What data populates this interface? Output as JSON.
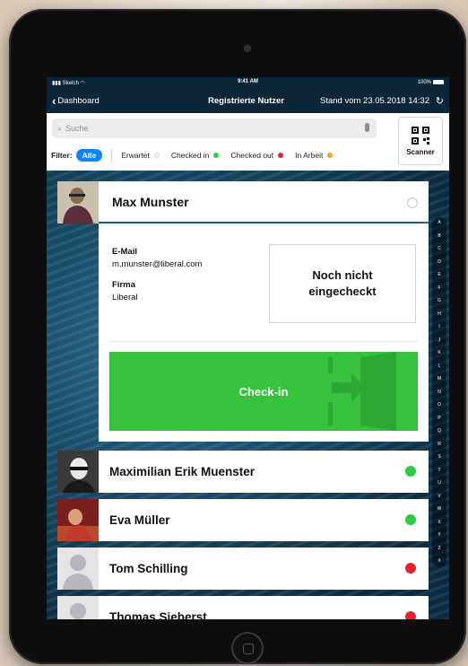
{
  "status": {
    "carrier": "Sketch",
    "time": "9:41 AM",
    "battery": "100%"
  },
  "nav": {
    "back_label": "Dashboard",
    "title": "Registrierte Nutzer",
    "stand": "Stand vom 23.05.2018 14:32"
  },
  "search": {
    "placeholder": "Suche"
  },
  "scanner": {
    "label": "Scanner"
  },
  "filters": {
    "label": "Filter:",
    "active": "Alle",
    "items": [
      {
        "label": "Erwartet",
        "color": "#ffffff"
      },
      {
        "label": "Checked in",
        "color": "#2ecc40"
      },
      {
        "label": "Checked out",
        "color": "#e8202a"
      },
      {
        "label": "In Arbeit",
        "color": "#f5a623"
      }
    ]
  },
  "selected": {
    "name": "Max Munster",
    "email_label": "E-Mail",
    "email": "m.munster@liberal.com",
    "company_label": "Firma",
    "company": "Liberal",
    "status_text": "Noch nicht eingecheckt",
    "checkin_label": "Check-in"
  },
  "list": [
    {
      "name": "Maximilian Erik Muenster",
      "status_color": "#2ecc40"
    },
    {
      "name": "Eva Müller",
      "status_color": "#2ecc40"
    },
    {
      "name": "Tom Schilling",
      "status_color": "#e8202a"
    },
    {
      "name": "Thomas Sieberst",
      "status_color": "#e8202a"
    }
  ],
  "index_letters": [
    "A",
    "B",
    "C",
    "D",
    "E",
    "F",
    "G",
    "H",
    "I",
    "J",
    "K",
    "L",
    "M",
    "N",
    "O",
    "P",
    "Q",
    "R",
    "S",
    "T",
    "U",
    "V",
    "W",
    "X",
    "Y",
    "Z",
    "#"
  ],
  "colors": {
    "accent": "#0a84ff",
    "checkin": "#36c23c"
  }
}
